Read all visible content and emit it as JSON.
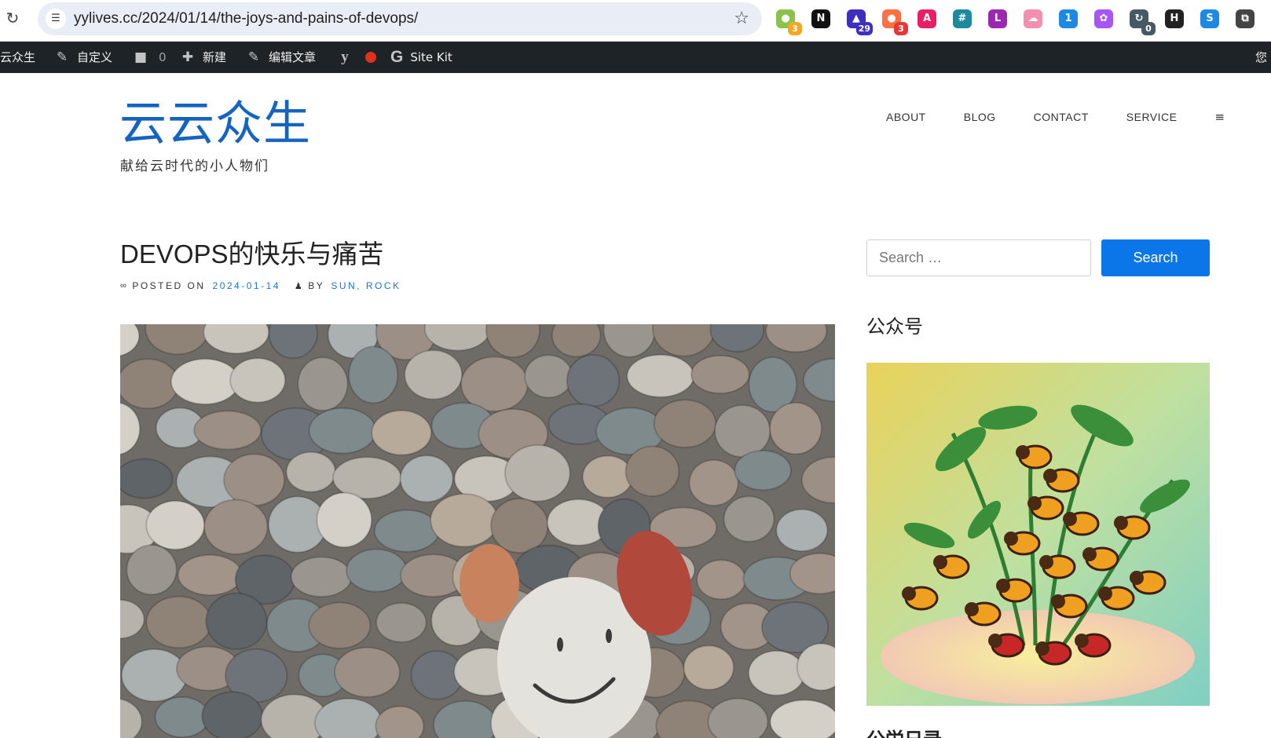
{
  "browser": {
    "url": "yylives.cc/2024/01/14/the-joys-and-pains-of-devops/",
    "extensions": [
      {
        "icon": "wechat-ext-icon",
        "glyph": "●",
        "color": "#8bc34a",
        "badge": "3",
        "badge_color": "#f5a623"
      },
      {
        "icon": "notion-icon",
        "glyph": "N",
        "color": "#111111",
        "badge": "",
        "badge_color": ""
      },
      {
        "icon": "graduation-cap-icon",
        "glyph": "▲",
        "color": "#3f2fbf",
        "badge": "29",
        "badge_color": "#3f2fbf"
      },
      {
        "icon": "cloud-ext-icon",
        "glyph": "●",
        "color": "#ff7043",
        "badge": "3",
        "badge_color": "#e53935"
      },
      {
        "icon": "translate-icon",
        "glyph": "A",
        "color": "#e91e63",
        "badge": "",
        "badge_color": ""
      },
      {
        "icon": "grid-ext-icon",
        "glyph": "#",
        "color": "#1b8a9e",
        "badge": "",
        "badge_color": ""
      },
      {
        "icon": "lr-ext-icon",
        "glyph": "L",
        "color": "#9c27b0",
        "badge": "",
        "badge_color": ""
      },
      {
        "icon": "weather-icon",
        "glyph": "☁",
        "color": "#f48fb1",
        "badge": "",
        "badge_color": ""
      },
      {
        "icon": "feather-ext-icon",
        "glyph": "1",
        "color": "#1e88e5",
        "badge": "",
        "badge_color": ""
      },
      {
        "icon": "openai-icon",
        "glyph": "✿",
        "color": "#a855f7",
        "badge": "",
        "badge_color": ""
      },
      {
        "icon": "sync-ext-icon",
        "glyph": "↻",
        "color": "#455a64",
        "badge": "0",
        "badge_color": "#455a64"
      },
      {
        "icon": "h-ext-icon",
        "glyph": "H",
        "color": "#222222",
        "badge": "",
        "badge_color": ""
      },
      {
        "icon": "circle-ext-icon",
        "glyph": "S",
        "color": "#1e88e5",
        "badge": "",
        "badge_color": ""
      },
      {
        "icon": "puzzle-icon",
        "glyph": "⧉",
        "color": "#444444",
        "badge": "",
        "badge_color": ""
      }
    ]
  },
  "adminbar": {
    "site_name": "云众生",
    "customize": "自定义",
    "comments_count": "0",
    "new": "新建",
    "edit": "编辑文章",
    "sitekit": "Site Kit",
    "right": "您"
  },
  "site": {
    "title": "云云众生",
    "description": "献给云时代的小人物们"
  },
  "nav": {
    "about": "ABOUT",
    "blog": "BLOG",
    "contact": "CONTACT",
    "service": "SERVICE",
    "menu_glyph": "≡"
  },
  "post": {
    "title": "DEVOPS的快乐与痛苦",
    "posted_on": "POSTED ON",
    "date": "2024-01-14",
    "by": "BY",
    "author": "SUN, ROCK"
  },
  "sidebar": {
    "search_placeholder": "Search …",
    "search_button": "Search",
    "widget_title": "公众号",
    "widget_title_2": "公栄日录"
  },
  "colors": {
    "link": "#1976d2",
    "site_title": "#1565c0",
    "search_button": "#0b76e8",
    "admin_bar": "#1d2327"
  }
}
